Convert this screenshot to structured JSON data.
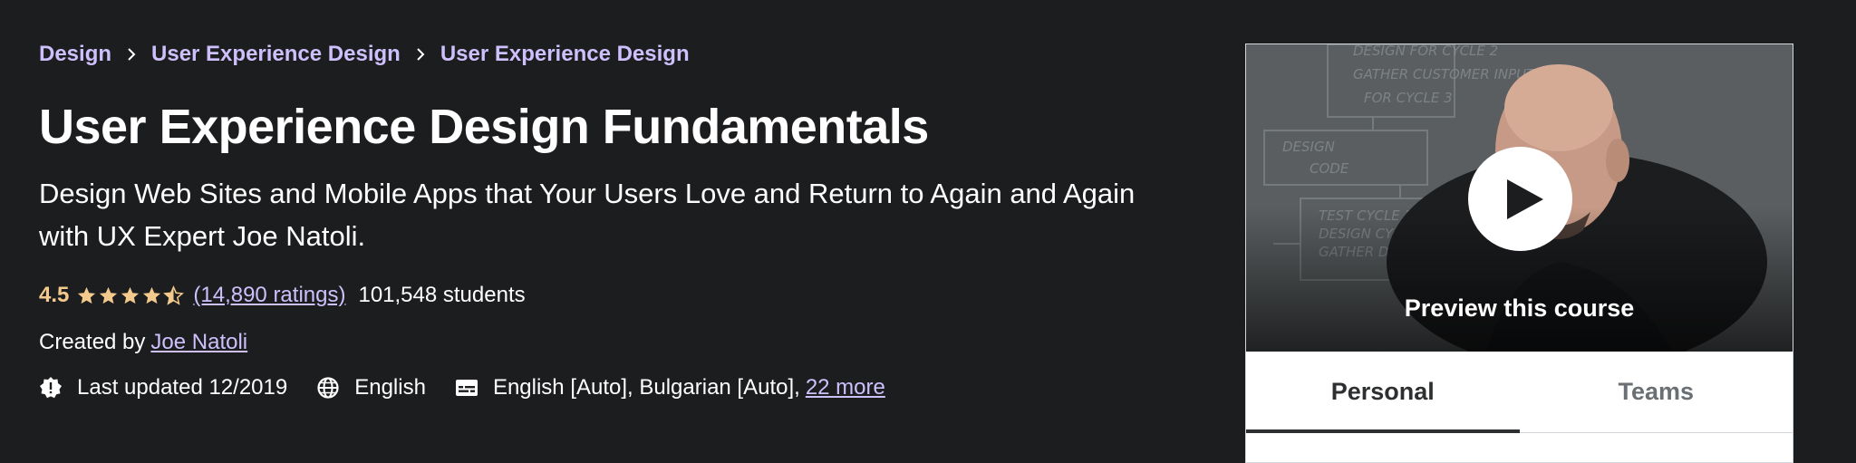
{
  "breadcrumb": [
    "Design",
    "User Experience Design",
    "User Experience Design"
  ],
  "course": {
    "title": "User Experience Design Fundamentals",
    "subtitle": "Design Web Sites and Mobile Apps that Your Users Love and Return to Again and Again with UX Expert Joe Natoli.",
    "rating": "4.5",
    "ratings_count": "(14,890 ratings)",
    "students": "101,548 students",
    "created_by_label": "Created by",
    "author": "Joe Natoli",
    "last_updated": "Last updated 12/2019",
    "language": "English",
    "captions": "English [Auto], Bulgarian [Auto],",
    "captions_more": "22 more"
  },
  "sidebar": {
    "preview_label": "Preview this course",
    "tabs": [
      "Personal",
      "Teams"
    ]
  },
  "colors": {
    "background": "#1c1d1f",
    "link": "#cec0fc",
    "rating": "#f3ca8c"
  },
  "icons": [
    "chevron-right-icon",
    "star-icon",
    "half-star-icon",
    "alert-badge-icon",
    "globe-icon",
    "closed-captions-icon",
    "play-icon"
  ]
}
